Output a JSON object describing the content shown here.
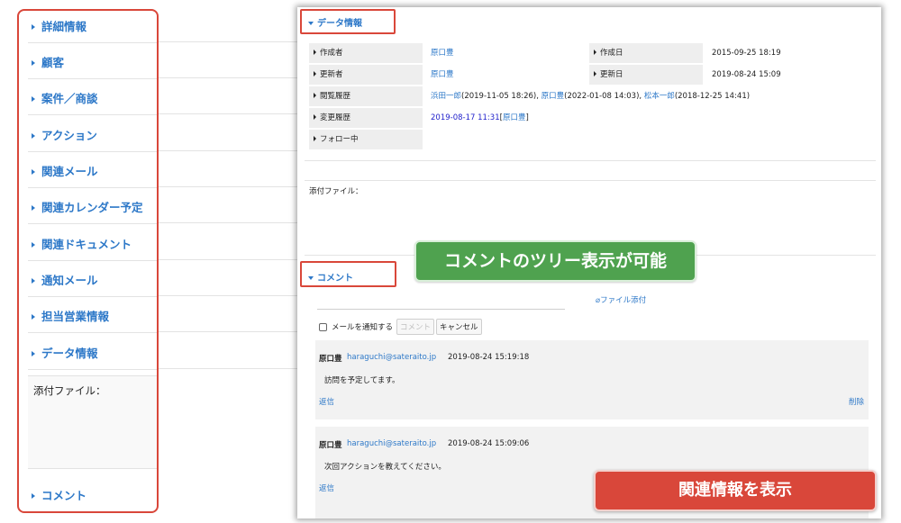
{
  "left_panel": {
    "items": [
      {
        "label": "詳細情報"
      },
      {
        "label": "顧客"
      },
      {
        "label": "案件／商談"
      },
      {
        "label": "アクション"
      },
      {
        "label": "関連メール"
      },
      {
        "label": "関連カレンダー予定"
      },
      {
        "label": "関連ドキュメント"
      },
      {
        "label": "通知メール"
      },
      {
        "label": "担当営業情報"
      },
      {
        "label": "データ情報"
      }
    ],
    "attachments_label": "添付ファイル：",
    "comment_label": "コメント"
  },
  "data_section": {
    "header": "データ情報",
    "created_by_label": "作成者",
    "created_by": "原口豊",
    "created_date_label": "作成日",
    "created_date": "2015-09-25 18:19",
    "updated_by_label": "更新者",
    "updated_by": "原口豊",
    "updated_date_label": "更新日",
    "updated_date": "2019-08-24 15:09",
    "view_history_label": "閲覧履歴",
    "view_history": [
      {
        "name": "浜田一郎",
        "time": "(2019-11-05 18:26), "
      },
      {
        "name": "原口豊",
        "time": "(2022-01-08 14:03), "
      },
      {
        "name": "松本一郎",
        "time": "(2018-12-25 14:41)"
      }
    ],
    "change_history_label": "変更履歴",
    "change_history_date": "2019-08-17 11:31",
    "change_history_user": "原口豊",
    "following_label": "フォロー中"
  },
  "attachments": {
    "label": "添付ファイル："
  },
  "comment_section": {
    "header": "コメント",
    "file_attach": "ファイル添付",
    "notify_label": "メールを通知する",
    "comment_button": "コメント",
    "cancel_button": "キャンセル",
    "comments": [
      {
        "author": "原口豊",
        "email": "haraguchi@sateraito.jp",
        "time": "2019-08-24 15:19:18",
        "body": "訪問を予定してます。",
        "reply": "返信",
        "delete": "削除"
      },
      {
        "author": "原口豊",
        "email": "haraguchi@sateraito.jp",
        "time": "2019-08-24 15:09:06",
        "body": "次回アクションを教えてください。",
        "reply": "返信"
      }
    ]
  },
  "callouts": {
    "tree": "コメントのツリー表示が可能",
    "related": "関連情報を表示"
  },
  "colors": {
    "accent": "#2d78c8",
    "highlight_red": "#d9473a",
    "callout_green": "#4fa24f"
  }
}
